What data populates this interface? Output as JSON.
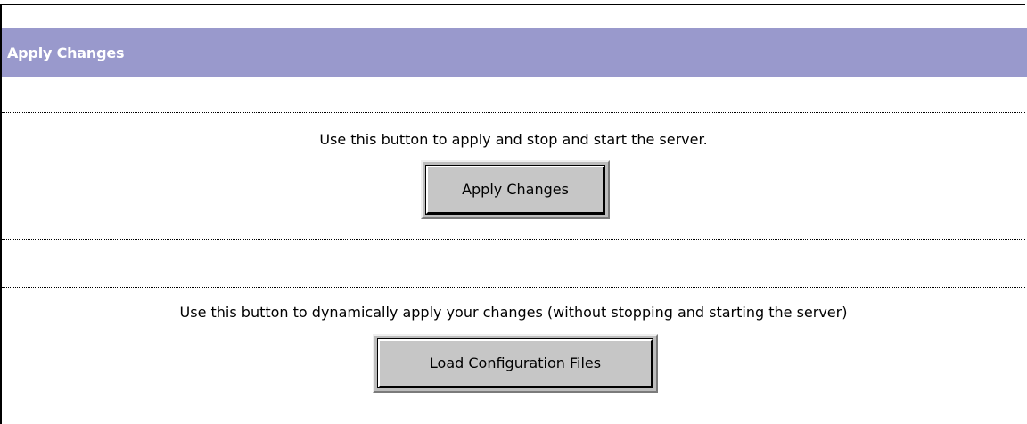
{
  "header": {
    "title": "Apply Changes"
  },
  "sections": [
    {
      "description": "Use this button to apply and stop and start the server.",
      "button_label": "Apply Changes"
    },
    {
      "description": "Use this button to dynamically apply your changes (without stopping and starting the server)",
      "button_label": "Load Configuration Files"
    }
  ],
  "colors": {
    "header_bg": "#9999cc",
    "header_text": "#ffffff",
    "button_face": "#c6c6c6"
  }
}
